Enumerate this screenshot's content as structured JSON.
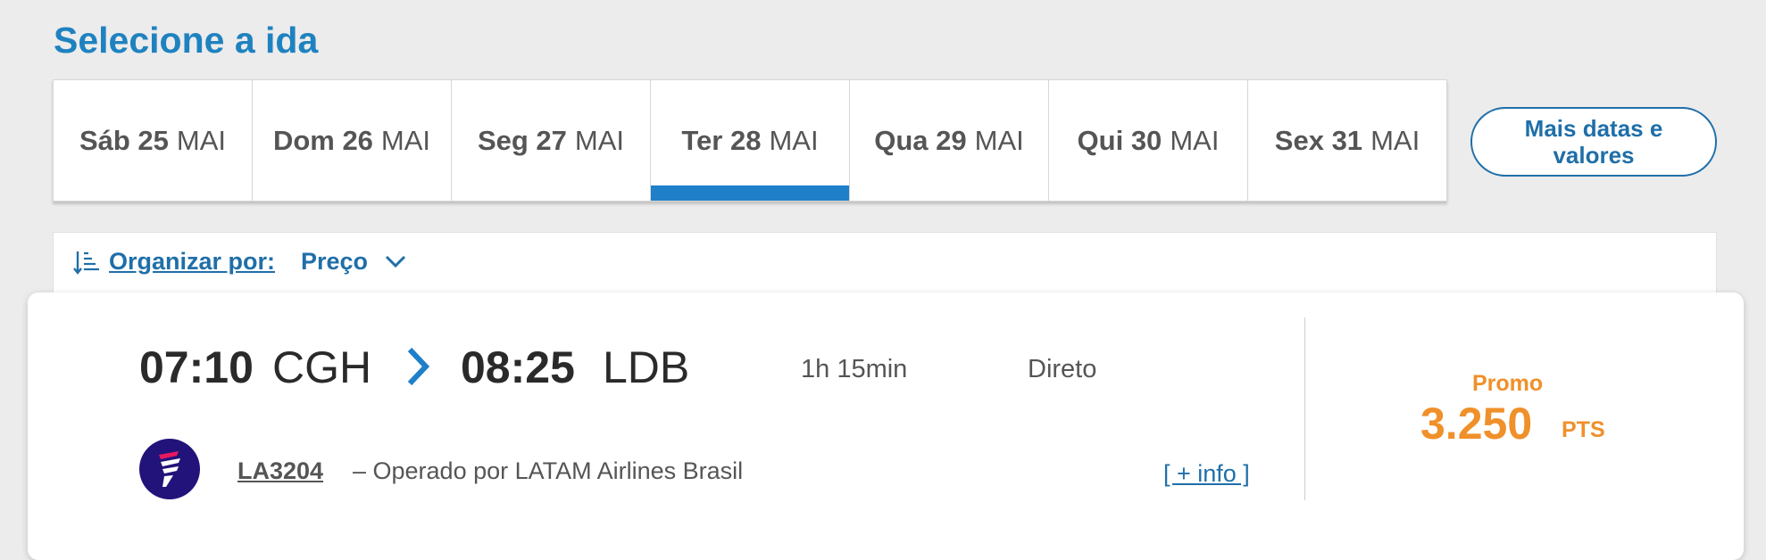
{
  "page_title": "Selecione a ida",
  "date_tabs": [
    {
      "weekday": "Sáb 25",
      "month": "MAI"
    },
    {
      "weekday": "Dom 26",
      "month": "MAI"
    },
    {
      "weekday": "Seg 27",
      "month": "MAI"
    },
    {
      "weekday": "Ter 28",
      "month": "MAI",
      "selected": true
    },
    {
      "weekday": "Qua 29",
      "month": "MAI"
    },
    {
      "weekday": "Qui 30",
      "month": "MAI"
    },
    {
      "weekday": "Sex 31",
      "month": "MAI"
    }
  ],
  "more_dates_label": "Mais datas e valores",
  "sort": {
    "label": "Organizar por:",
    "value": "Preço",
    "icon": "sort-icon"
  },
  "flight": {
    "departure_time": "07:10",
    "departure_airport": "CGH",
    "arrival_time": "08:25",
    "arrival_airport": "LDB",
    "duration": "1h 15min",
    "stops": "Direto",
    "flight_number": "LA3204",
    "operator": "– Operado por LATAM Airlines Brasil",
    "more_info": "[ + info ]",
    "fare_label": "Promo",
    "price": "3.250",
    "price_unit": "PTS"
  },
  "colors": {
    "brand_blue": "#1f82c0",
    "accent_orange": "#f0902a",
    "latam_indigo": "#22137a"
  }
}
